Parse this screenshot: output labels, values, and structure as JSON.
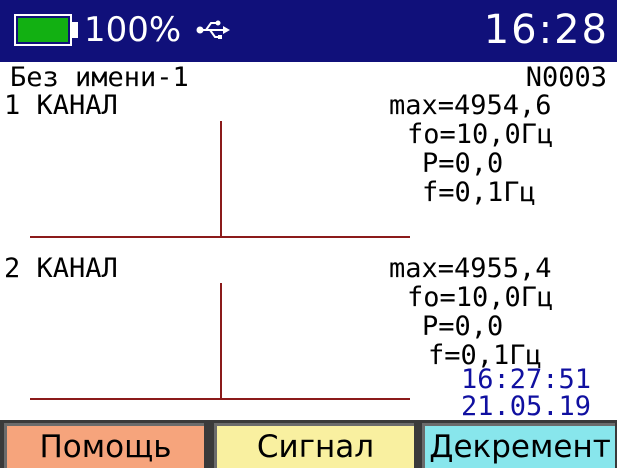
{
  "status": {
    "battery_percent": "100%",
    "battery_level": 1.0,
    "time": "16:28",
    "battery_fill_color": "#12b012",
    "bar_color": "#10107a"
  },
  "header": {
    "filename": "Без имени-1",
    "record_number": "N0003"
  },
  "channels": [
    {
      "label": "1 КАНАЛ",
      "max": "max=4954,6",
      "f0": "fo=10,0Гц",
      "p": "P=0,0",
      "f": "f=0,1Гц"
    },
    {
      "label": "2 КАНАЛ",
      "max": "max=4955,4",
      "f0": "fo=10,0Гц",
      "p": "P=0,0",
      "f": "f=0,1Гц"
    }
  ],
  "timestamp": {
    "time": "16:27:51",
    "date": "21.05.19"
  },
  "softkeys": [
    {
      "label": "Помощь",
      "color": "#f6a47c"
    },
    {
      "label": "Сигнал",
      "color": "#f9f0a0"
    },
    {
      "label": "Декремент",
      "color": "#88e6ec"
    }
  ],
  "icons": {
    "battery": "battery-icon",
    "usb": "usb-icon"
  }
}
